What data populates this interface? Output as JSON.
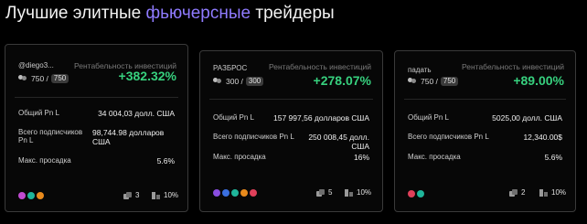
{
  "header": {
    "title_prefix": "Лучшие элитные ",
    "title_accent": "фьючерсные",
    "title_suffix": " трейдеры"
  },
  "colors": {
    "accent": "#8f7bff",
    "roi_green": "#37d07e"
  },
  "cards": [
    {
      "name": "@diego3...",
      "roi_label": "Рентабельность инвестиций",
      "roi": "+382.32%",
      "subs_current": "750 /",
      "subs_max": "750",
      "pnl_label": "Общий Pn L",
      "pnl_value": "34 004,03 долл. США",
      "followers_label": "Всего подписчиков Pn L",
      "followers_value": "98,744.98 долларов США",
      "drawdown_label": "Макс. просадка",
      "drawdown_value": "5.6%",
      "coins": [
        "pink",
        "teal",
        "orange"
      ],
      "copies": "3",
      "share": "10%"
    },
    {
      "name": "РАЗБРОС",
      "roi_label": "Рентабельность инвестиций",
      "roi": "+278.07%",
      "subs_current": "300 /",
      "subs_max": "300",
      "pnl_label": "Общий Pn L",
      "pnl_value": "157 997,56 долларов США",
      "followers_label": "Всего подписчиков Pn L",
      "followers_value": "250 008,45 долл. США",
      "drawdown_label": "Макс. просадка",
      "drawdown_value": "16%",
      "coins": [
        "purple",
        "blue",
        "teal",
        "orange",
        "red"
      ],
      "copies": "5",
      "share": "10%"
    },
    {
      "name": "падать",
      "roi_label": "Рентабельность инвестиций",
      "roi": "+89.00%",
      "subs_current": "750 /",
      "subs_max": "750",
      "pnl_label": "Общий Pn L",
      "pnl_value": "5025,00 долл. США",
      "followers_label": "Всего подписчиков Pn L",
      "followers_value": "12,340.00$",
      "drawdown_label": "Макс. просадка",
      "drawdown_value": "5.6%",
      "coins": [
        "red",
        "teal"
      ],
      "copies": "2",
      "share": "10%"
    }
  ]
}
